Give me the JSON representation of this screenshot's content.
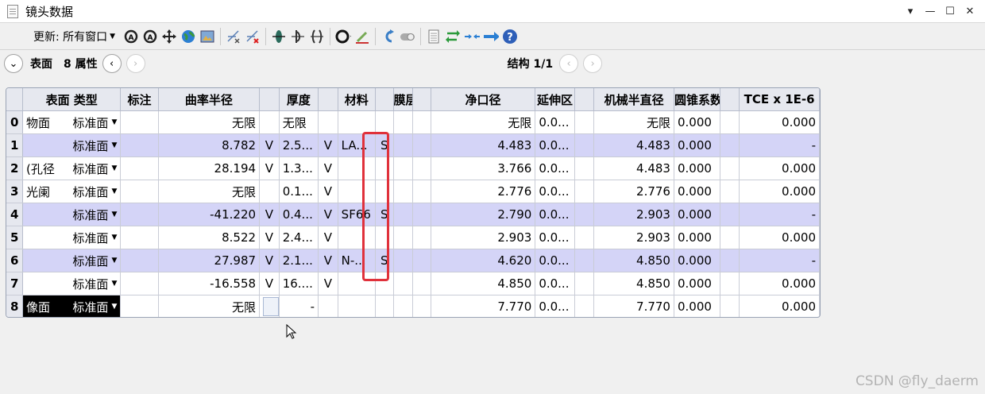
{
  "window": {
    "title": "镜头数据",
    "controls": [
      "▾",
      "—",
      "☐",
      "✕"
    ]
  },
  "toolbar": {
    "update_label": "更新: 所有窗口",
    "icons": [
      "refresh-all-icon",
      "refresh-icon",
      "move-icon",
      "globe-icon",
      "image-icon",
      "insert-surface-icon",
      "delete-surface-icon",
      "lens-icon",
      "stop-icon",
      "mirror-icon",
      "circle-options-icon",
      "brush-icon",
      "undo-icon",
      "toggle-icon",
      "notes-icon",
      "swap-icon",
      "arrows-in-icon",
      "arrow-right-icon",
      "help-icon"
    ]
  },
  "navbar": {
    "surface_label": "表面",
    "props_label": "8 属性",
    "config_label": "结构 1/1"
  },
  "table": {
    "headers": [
      "",
      "表面 类型",
      "标注",
      "曲率半径",
      "",
      "厚度",
      "",
      "材料",
      "",
      "膜层",
      "",
      "净口径",
      "延伸区",
      "",
      "机械半直径",
      "圆锥系数",
      "",
      "TCE x 1E-6"
    ],
    "rows": [
      {
        "n": "0",
        "comment": "物面",
        "type": "标准面",
        "note": "",
        "radius": "无限",
        "rs": "",
        "thick": "无限",
        "ts": "",
        "mat": "",
        "ms": "",
        "coat": "",
        "cs": "",
        "semi": "无限",
        "ext": "0.0...",
        "es": "",
        "mech": "无限",
        "conic": "0.000",
        "ks": "",
        "tce": "0.000",
        "hl": false
      },
      {
        "n": "1",
        "comment": "",
        "type": "标准面",
        "note": "",
        "radius": "8.782",
        "rs": "V",
        "thick": "2.5...",
        "ts": "V",
        "mat": "LA...",
        "ms": "S",
        "coat": "",
        "cs": "",
        "semi": "4.483",
        "ext": "0.0...",
        "es": "",
        "mech": "4.483",
        "conic": "0.000",
        "ks": "",
        "tce": "-",
        "hl": true
      },
      {
        "n": "2",
        "comment": "(孔径",
        "type": "标准面",
        "note": "",
        "radius": "28.194",
        "rs": "V",
        "thick": "1.3...",
        "ts": "V",
        "mat": "",
        "ms": "",
        "coat": "",
        "cs": "",
        "semi": "3.766",
        "ext": "0.0...",
        "es": "",
        "mech": "4.483",
        "conic": "0.000",
        "ks": "",
        "tce": "0.000",
        "hl": false
      },
      {
        "n": "3",
        "comment": "光阑",
        "type": "标准面",
        "note": "",
        "radius": "无限",
        "rs": "",
        "thick": "0.1...",
        "ts": "V",
        "mat": "",
        "ms": "",
        "coat": "",
        "cs": "",
        "semi": "2.776",
        "ext": "0.0...",
        "es": "",
        "mech": "2.776",
        "conic": "0.000",
        "ks": "",
        "tce": "0.000",
        "hl": false
      },
      {
        "n": "4",
        "comment": "",
        "type": "标准面",
        "note": "",
        "radius": "-41.220",
        "rs": "V",
        "thick": "0.4...",
        "ts": "V",
        "mat": "SF66",
        "ms": "S",
        "coat": "",
        "cs": "",
        "semi": "2.790",
        "ext": "0.0...",
        "es": "",
        "mech": "2.903",
        "conic": "0.000",
        "ks": "",
        "tce": "-",
        "hl": true
      },
      {
        "n": "5",
        "comment": "",
        "type": "标准面",
        "note": "",
        "radius": "8.522",
        "rs": "V",
        "thick": "2.4...",
        "ts": "V",
        "mat": "",
        "ms": "",
        "coat": "",
        "cs": "",
        "semi": "2.903",
        "ext": "0.0...",
        "es": "",
        "mech": "2.903",
        "conic": "0.000",
        "ks": "",
        "tce": "0.000",
        "hl": false
      },
      {
        "n": "6",
        "comment": "",
        "type": "标准面",
        "note": "",
        "radius": "27.987",
        "rs": "V",
        "thick": "2.1...",
        "ts": "V",
        "mat": "N-...",
        "ms": "S",
        "coat": "",
        "cs": "",
        "semi": "4.620",
        "ext": "0.0...",
        "es": "",
        "mech": "4.850",
        "conic": "0.000",
        "ks": "",
        "tce": "-",
        "hl": true
      },
      {
        "n": "7",
        "comment": "",
        "type": "标准面",
        "note": "",
        "radius": "-16.558",
        "rs": "V",
        "thick": "16....",
        "ts": "V",
        "mat": "",
        "ms": "",
        "coat": "",
        "cs": "",
        "semi": "4.850",
        "ext": "0.0...",
        "es": "",
        "mech": "4.850",
        "conic": "0.000",
        "ks": "",
        "tce": "0.000",
        "hl": false
      },
      {
        "n": "8",
        "comment": "像面",
        "type": "标准面",
        "note": "",
        "radius": "无限",
        "rs": "",
        "thick": "-",
        "ts": "",
        "mat": "",
        "ms": "",
        "coat": "",
        "cs": "",
        "semi": "7.770",
        "ext": "0.0...",
        "es": "",
        "mech": "7.770",
        "conic": "0.000",
        "ks": "",
        "tce": "0.000",
        "hl": false,
        "selected": true
      }
    ]
  },
  "highlight_color": "#e0313b",
  "row_highlight_color": "#d4d4f7",
  "watermark": "CSDN @fly_daerm"
}
